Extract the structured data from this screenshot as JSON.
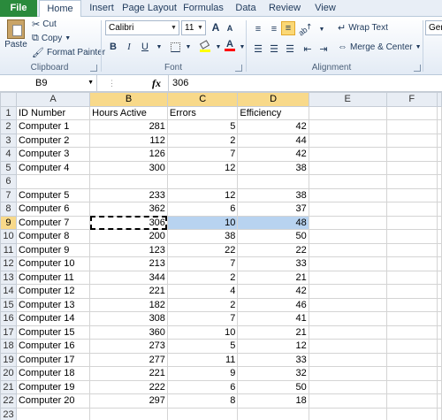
{
  "tabs": [
    "File",
    "Home",
    "Insert",
    "Page Layout",
    "Formulas",
    "Data",
    "Review",
    "View"
  ],
  "clipboard": {
    "paste_label": "Paste",
    "cut_label": "Cut",
    "copy_label": "Copy",
    "format_painter_label": "Format Painter",
    "group_label": "Clipboard"
  },
  "font": {
    "family": "Calibri",
    "size": "11",
    "bold_label": "B",
    "italic_label": "I",
    "underline_label": "U",
    "grow_label": "A",
    "shrink_label": "A",
    "font_color_label": "A",
    "group_label": "Font"
  },
  "alignment": {
    "wrap_text_label": "Wrap Text",
    "merge_center_label": "Merge & Center",
    "group_label": "Alignment"
  },
  "number": {
    "format": "Gene"
  },
  "formula_bar": {
    "name_box": "B9",
    "fx_label": "fx",
    "value": "306"
  },
  "sheet": {
    "columns": [
      "A",
      "B",
      "C",
      "D",
      "E",
      "F"
    ],
    "rows": [
      {
        "n": "1",
        "a": "ID Number",
        "b": "Hours Active",
        "c": "Errors",
        "d": "Efficiency",
        "header": true
      },
      {
        "n": "2",
        "a": "Computer 1",
        "b": "281",
        "c": "5",
        "d": "42"
      },
      {
        "n": "3",
        "a": "Computer 2",
        "b": "112",
        "c": "2",
        "d": "44"
      },
      {
        "n": "4",
        "a": "Computer 3",
        "b": "126",
        "c": "7",
        "d": "42"
      },
      {
        "n": "5",
        "a": "Computer 4",
        "b": "300",
        "c": "12",
        "d": "38"
      },
      {
        "n": "6",
        "a": "",
        "b": "",
        "c": "",
        "d": ""
      },
      {
        "n": "7",
        "a": "Computer 5",
        "b": "233",
        "c": "12",
        "d": "38"
      },
      {
        "n": "8",
        "a": "Computer 6",
        "b": "362",
        "c": "6",
        "d": "37"
      },
      {
        "n": "9",
        "a": "Computer 7",
        "b": "306",
        "c": "10",
        "d": "48",
        "selected": true
      },
      {
        "n": "10",
        "a": "Computer 8",
        "b": "200",
        "c": "38",
        "d": "50"
      },
      {
        "n": "11",
        "a": "Computer 9",
        "b": "123",
        "c": "22",
        "d": "22"
      },
      {
        "n": "12",
        "a": "Computer 10",
        "b": "213",
        "c": "7",
        "d": "33"
      },
      {
        "n": "13",
        "a": "Computer 11",
        "b": "344",
        "c": "2",
        "d": "21"
      },
      {
        "n": "14",
        "a": "Computer 12",
        "b": "221",
        "c": "4",
        "d": "42"
      },
      {
        "n": "15",
        "a": "Computer 13",
        "b": "182",
        "c": "2",
        "d": "46"
      },
      {
        "n": "16",
        "a": "Computer 14",
        "b": "308",
        "c": "7",
        "d": "41"
      },
      {
        "n": "17",
        "a": "Computer 15",
        "b": "360",
        "c": "10",
        "d": "21"
      },
      {
        "n": "18",
        "a": "Computer 16",
        "b": "273",
        "c": "5",
        "d": "12"
      },
      {
        "n": "19",
        "a": "Computer 17",
        "b": "277",
        "c": "11",
        "d": "33"
      },
      {
        "n": "20",
        "a": "Computer 18",
        "b": "221",
        "c": "9",
        "d": "32"
      },
      {
        "n": "21",
        "a": "Computer 19",
        "b": "222",
        "c": "6",
        "d": "50"
      },
      {
        "n": "22",
        "a": "Computer 20",
        "b": "297",
        "c": "8",
        "d": "18"
      },
      {
        "n": "23",
        "a": "",
        "b": "",
        "c": "",
        "d": ""
      }
    ]
  }
}
